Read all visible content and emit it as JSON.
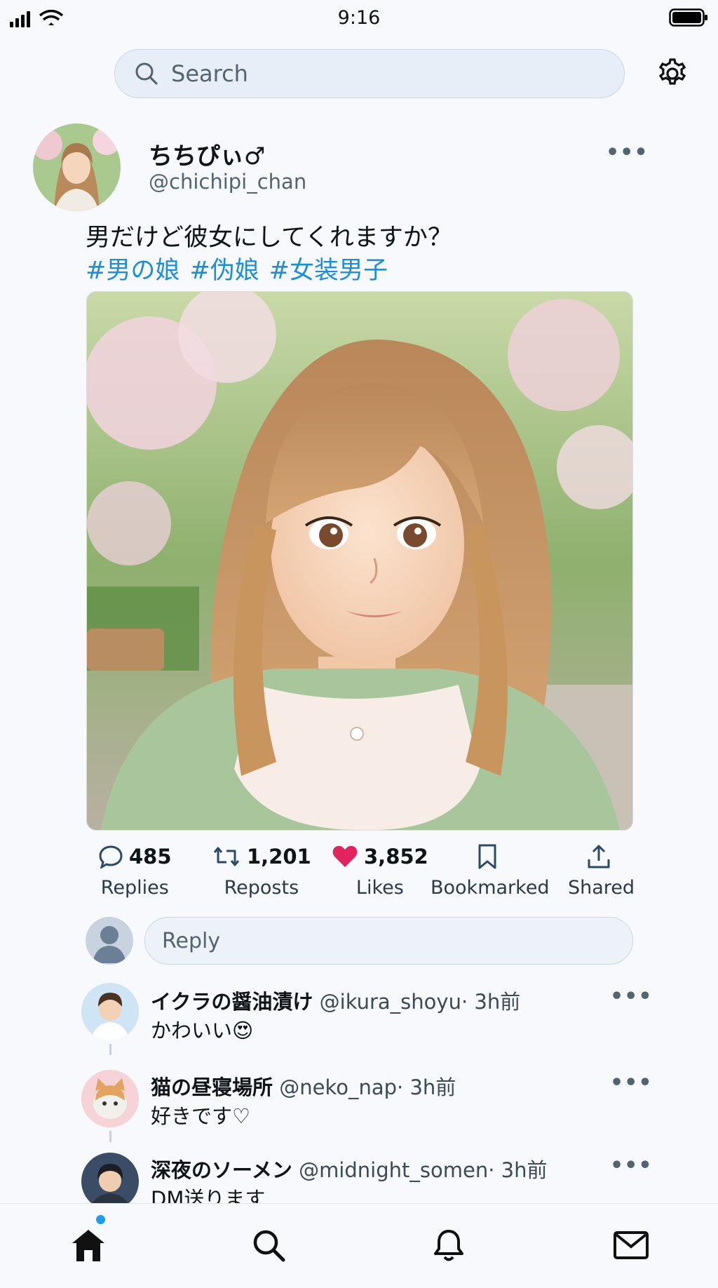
{
  "status_bar": {
    "time": "9:16"
  },
  "search": {
    "placeholder": "Search"
  },
  "post": {
    "display_name": "ちちぴぃ♂",
    "handle": "@chichipi_chan",
    "text": "男だけど彼女にしてくれますか？",
    "hashtags": [
      "#男の娘",
      "#伪娘",
      "#女装男子"
    ],
    "image_icon": "anime-portrait-image"
  },
  "actions": [
    {
      "count": "485",
      "label": "Replies",
      "icon": "reply-icon"
    },
    {
      "count": "1,201",
      "label": "Reposts",
      "icon": "repost-icon"
    },
    {
      "count": "3,852",
      "label": "Likes",
      "icon": "heart-icon",
      "color": "#e0245e"
    },
    {
      "count": "",
      "label": "Bookmarked",
      "icon": "bookmark-icon"
    },
    {
      "count": "",
      "label": "Shared",
      "icon": "share-icon"
    }
  ],
  "reply_input": {
    "placeholder": "Reply"
  },
  "comments": [
    {
      "name": "イクラの醤油漬け",
      "handle": "@ikura_shoyu",
      "time": "· 3h前",
      "text": "かわいい😍"
    },
    {
      "name": "猫の昼寝場所",
      "handle": "@neko_nap",
      "time": "· 3h前",
      "text": "好きです♡"
    },
    {
      "name": "深夜のソーメン",
      "handle": "@midnight_somen",
      "time": "· 3h前",
      "text": "DM送ります"
    }
  ],
  "more_icon": "•••",
  "bottom_nav": [
    "home-icon",
    "search-icon",
    "bell-icon",
    "mail-icon"
  ],
  "colors": {
    "accent": "#1d9bf0",
    "hashtag": "#1d8fd8",
    "like": "#e0245e",
    "background": "#f7f9fc"
  }
}
